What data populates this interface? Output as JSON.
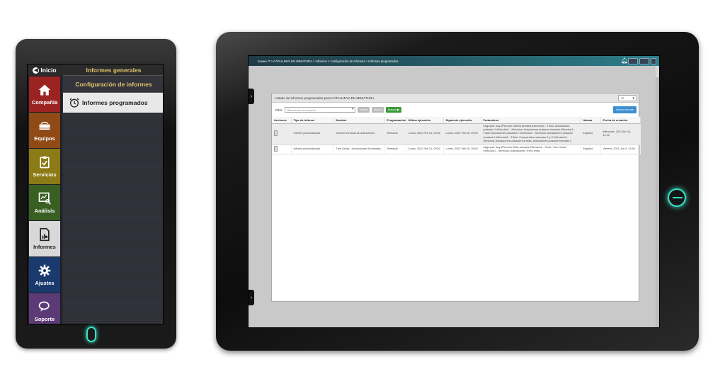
{
  "phone": {
    "inicio": "Inicio",
    "tiles": [
      {
        "label": "Compañía",
        "icon": "home-icon",
        "color": "#9b2423"
      },
      {
        "label": "Equipos",
        "icon": "router-icon",
        "color": "#8f4a16"
      },
      {
        "label": "Servicios",
        "icon": "clipboard-check-icon",
        "color": "#8b7a15"
      },
      {
        "label": "Análisis",
        "icon": "chart-search-icon",
        "color": "#3a5f23"
      },
      {
        "label": "Informes",
        "icon": "report-icon",
        "color": "#d8d8d8"
      },
      {
        "label": "Ajustes",
        "icon": "gear-icon",
        "color": "#1a3a6d"
      },
      {
        "label": "Soporte",
        "icon": "chat-icon",
        "color": "#5c3a76"
      }
    ],
    "menu": {
      "header": "Informes generales",
      "sub": "Configuración de informes",
      "active": "Informes programados"
    }
  },
  "tablet": {
    "breadcrumb": "Inavea IT > CATALUNYA EN MINIATURA > Informes > Configuración de informes > Informes programados",
    "topbar_buttons": [
      "",
      "",
      ""
    ],
    "panel": {
      "title": "Listado de informes programados para CATALUNYA EN MINIATURA",
      "page_size": "10",
      "filter_label": "Filtro:",
      "filter_placeholder": "Seleccione una opción",
      "btn_add": "Añadir",
      "btn_clear": "Borrar",
      "btn_search": "Buscar ▶",
      "btn_new": "Nuevo informe",
      "columns": [
        "Acciones",
        "Tipo de informe",
        "Nombre",
        "Programación",
        "Última ejecución",
        "Siguiente ejecución",
        "Parámetros",
        "Idioma",
        "Fecha de creación"
      ],
      "rows": [
        {
          "tipo": "Informe personalizado",
          "nombre": "Informe semanal de actuaciones",
          "programacion": "Semanal",
          "ultima": "Lunes, 2022 Feb 21, 09:02",
          "siguiente": "Lunes, 2022 Feb 28, 09:02",
          "parametros": "#Agrupar: day #Período: Última semana #Sección0 - Título: Actuaciones pulsador 1 #Sección1 - Servicios: Actuaciones pulsador horarias #Sección1 - Título: Actuaciones pulsador 2 #Sección2 - Servicios: Actuaciones pulsador horarias 2 #Sección2 - Título: Comparativa marcador 1 y 2 #Sección3 - Servicios: Actuaciones pulsador horarias, Actuaciones pulsador horarias 2",
          "idioma": "Español",
          "fecha": "Miércoles, 2021 Abr 14, 11:15"
        },
        {
          "tipo": "Informe personalizado",
          "nombre": "Tren Lleida - Activaciones Semanales",
          "programacion": "Semanal",
          "ultima": "Lunes, 2022 Feb 21, 09:02",
          "siguiente": "Lunes, 2022 Feb 28, 09:02",
          "parametros": "#Agrupar: day #Período: Esta semana #Sección1 - Título: Tren Lleida #Sección1 - Servicios: Activaciones Tren Lleida",
          "idioma": "Español",
          "fecha": "Viernes, 2021 Jun 4, 13:54"
        }
      ]
    }
  }
}
